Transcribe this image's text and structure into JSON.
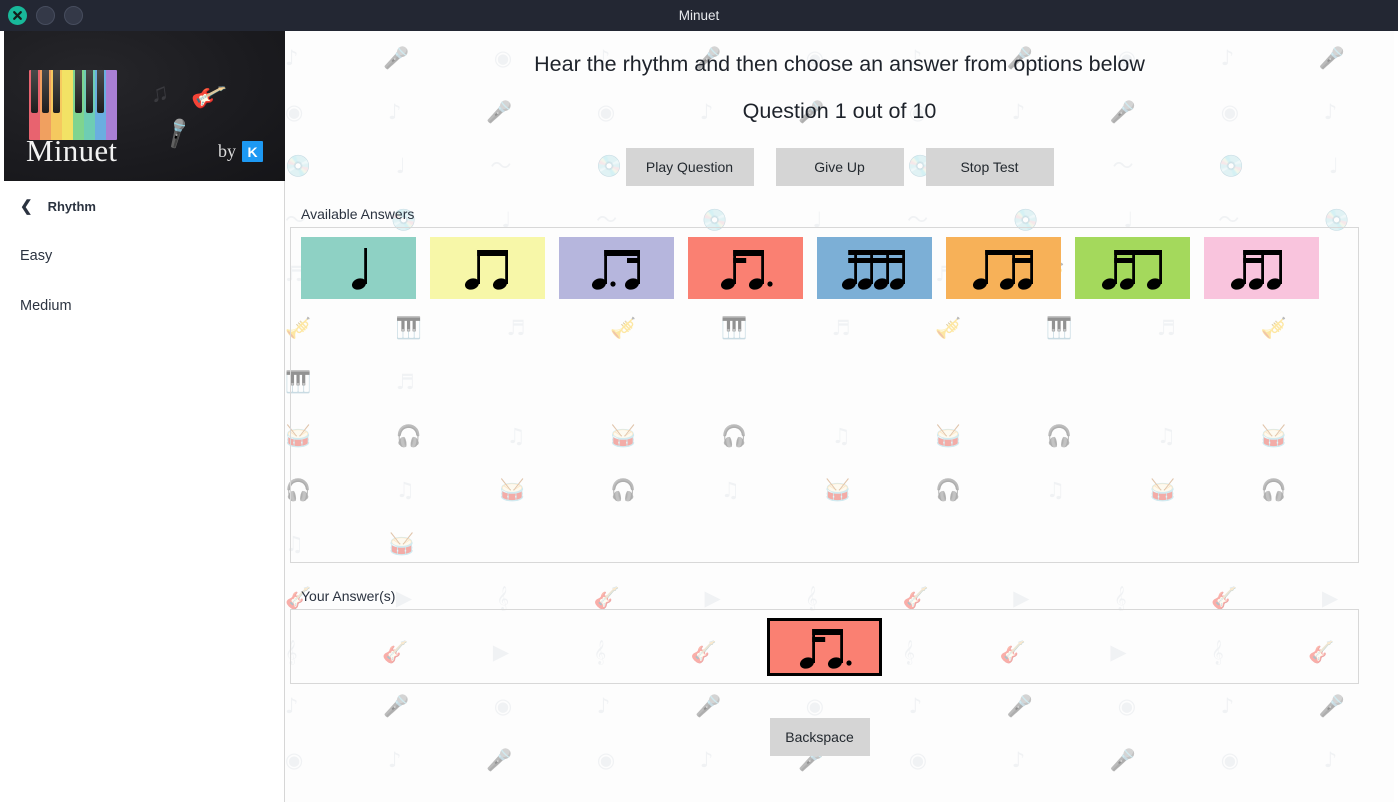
{
  "window": {
    "title": "Minuet",
    "controls": [
      {
        "name": "close",
        "icon": "close-icon"
      },
      {
        "name": "minimize",
        "icon": "minimize-icon"
      },
      {
        "name": "maximize",
        "icon": "maximize-icon"
      }
    ]
  },
  "sidebar": {
    "logo": {
      "wordmark": "Minuet",
      "by_text": "by",
      "kde_badge": "K",
      "piano_colors": [
        "#e8636f",
        "#f0a060",
        "#f5c95f",
        "#f2e265",
        "#7fd48f",
        "#6ecdb4",
        "#6aaee0",
        "#a97fd4"
      ]
    },
    "back_label": "Rhythm",
    "back_icon": "chevron-left-icon",
    "items": [
      {
        "label": "Easy"
      },
      {
        "label": "Medium"
      }
    ]
  },
  "main": {
    "prompt": "Hear the rhythm and then choose an answer from options below",
    "question_counter": "Question 1 out of 10",
    "buttons": {
      "play": "Play Question",
      "give_up": "Give Up",
      "stop": "Stop Test",
      "backspace": "Backspace"
    },
    "available_answers_label": "Available Answers",
    "your_answers_label": "Your Answer(s)",
    "available_answers": [
      {
        "id": "quarter-note",
        "color": "#8ed1c4",
        "rhythm": "quarter"
      },
      {
        "id": "two-eighths",
        "color": "#f7f7a8",
        "rhythm": "two-eighths"
      },
      {
        "id": "dotted-eighth-sixteenth",
        "color": "#b6b6dd",
        "rhythm": "dotted-eighth-sixteenth"
      },
      {
        "id": "sixteenth-dotted-eighth",
        "color": "#fa8072",
        "rhythm": "sixteenth-dotted-eighth"
      },
      {
        "id": "four-sixteenths",
        "color": "#7cafd6",
        "rhythm": "four-sixteenths"
      },
      {
        "id": "eighth-two-sixteenths",
        "color": "#f7b158",
        "rhythm": "eighth-two-sixteenths"
      },
      {
        "id": "two-sixteenths-eighth",
        "color": "#a4d95c",
        "rhythm": "two-sixteenths-eighth"
      },
      {
        "id": "sixteenth-eighth-sixteenth",
        "color": "#f9c4dd",
        "rhythm": "sixteenth-eighth-sixteenth"
      }
    ],
    "your_answers": [
      {
        "id": "sixteenth-dotted-eighth",
        "color": "#fa8072",
        "rhythm": "sixteenth-dotted-eighth"
      }
    ]
  },
  "pattern_glyphs": "♪ ▶ ♫ ⚇ ♬ ☊ ♩ ◉ ♪ ▷ ♫ ⚉ ♬ ☋ ♩ ◎"
}
